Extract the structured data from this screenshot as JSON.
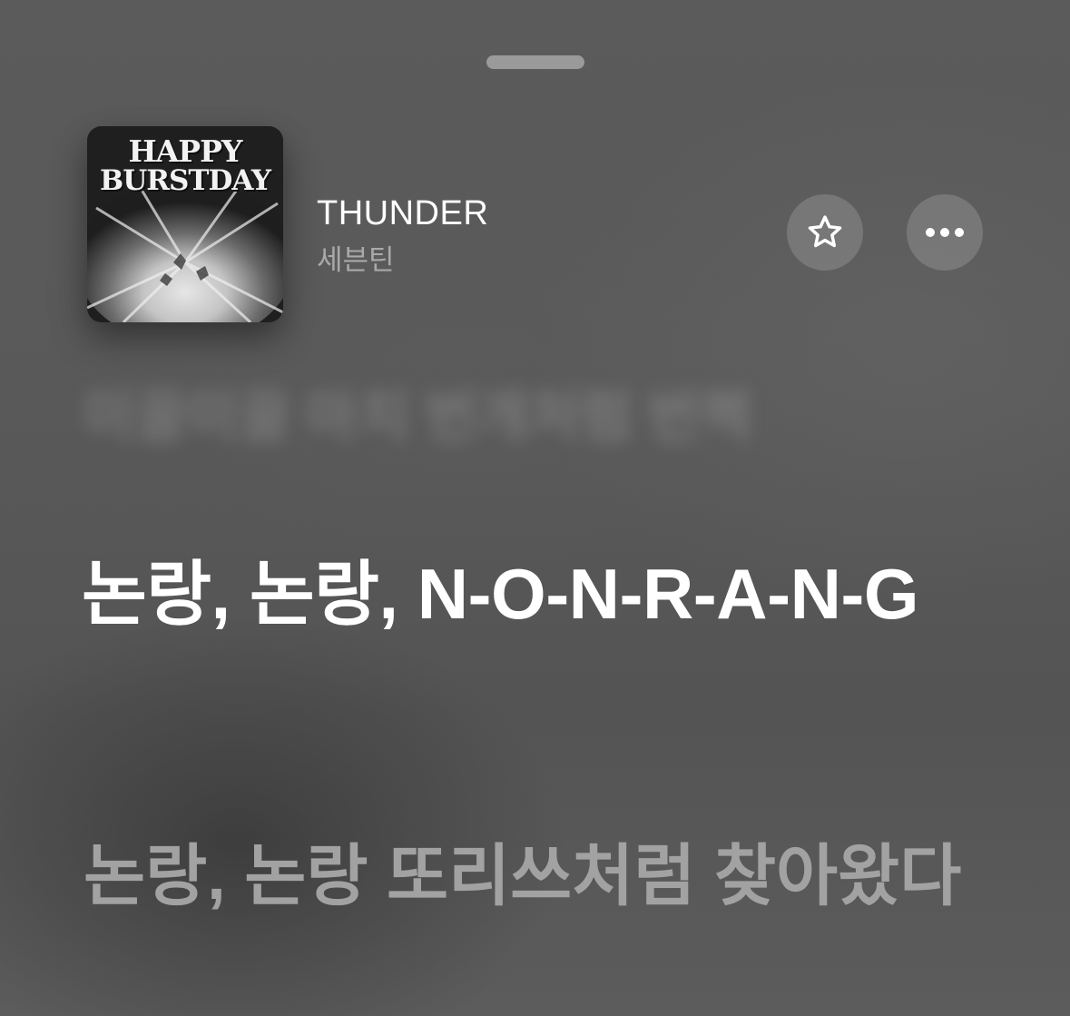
{
  "now_playing": {
    "artwork": {
      "title_line1": "HAPPY",
      "title_line2": "BURSTDAY",
      "icon": "album-artwork"
    },
    "title": "THUNDER",
    "artist": "세븐틴",
    "actions": {
      "favorite_icon": "star-icon",
      "more_icon": "ellipsis-icon"
    }
  },
  "lyrics": {
    "previous_line": "미끌미끌 마치 번개처럼 번쩍",
    "current_line": "논랑, 논랑, N-O-N-R-A-N-G",
    "next_line": "논랑, 논랑 또리쓰처럼 찾아왔다"
  },
  "colors": {
    "background": "#5a5a5a",
    "active_lyric": "#ffffff",
    "inactive_lyric": "#a2a2a2",
    "artist_text": "#a9a9a9"
  }
}
